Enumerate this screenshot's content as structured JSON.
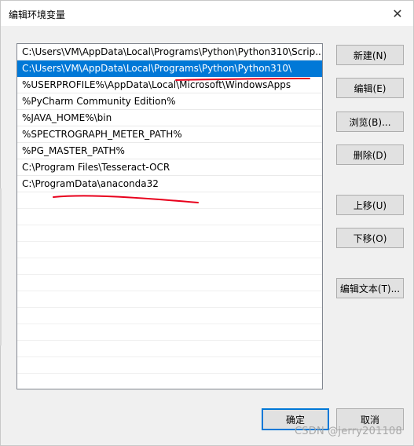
{
  "window": {
    "title": "编辑环境变量",
    "close_label": "✕"
  },
  "paths": [
    "C:\\Users\\VM\\AppData\\Local\\Programs\\Python\\Python310\\Scrip...",
    "C:\\Users\\VM\\AppData\\Local\\Programs\\Python\\Python310\\",
    "%USERPROFILE%\\AppData\\Local\\Microsoft\\WindowsApps",
    "%PyCharm Community Edition%",
    "%JAVA_HOME%\\bin",
    "%SPECTROGRAPH_METER_PATH%",
    "%PG_MASTER_PATH%",
    "C:\\Program Files\\Tesseract-OCR",
    "C:\\ProgramData\\anaconda32"
  ],
  "selected_index": 1,
  "buttons": {
    "new": "新建(N)",
    "edit": "编辑(E)",
    "browse": "浏览(B)...",
    "delete": "删除(D)",
    "move_up": "上移(U)",
    "move_down": "下移(O)",
    "edit_text": "编辑文本(T)...",
    "ok": "确定",
    "cancel": "取消"
  },
  "watermark": "CSDN @jerry201108",
  "colors": {
    "selection": "#0078d7",
    "annotation": "#e8001c"
  }
}
